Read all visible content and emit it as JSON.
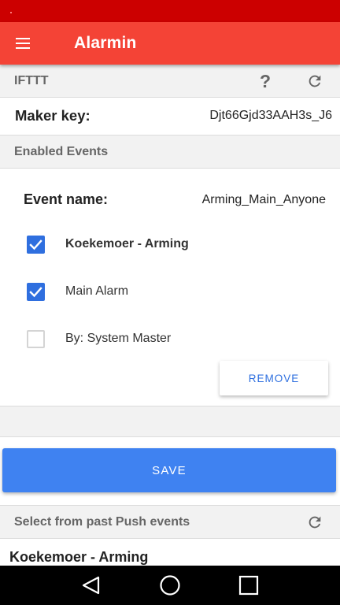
{
  "app_bar": {
    "title": "Alarmin",
    "menu_icon": "menu-icon"
  },
  "ifttt_section": {
    "header": "IFTTT",
    "help_glyph": "?",
    "refresh_icon": "refresh-icon"
  },
  "maker": {
    "label": "Maker key:",
    "value": "Djt66Gjd33AAH3s_J6"
  },
  "enabled_events": {
    "header": "Enabled Events",
    "event_name_label": "Event name:",
    "event_name_value": "Arming_Main_Anyone",
    "options": [
      {
        "label": "Koekemoer - Arming",
        "checked": true
      },
      {
        "label": "Main Alarm",
        "checked": true
      },
      {
        "label": "By: System Master",
        "checked": false
      }
    ],
    "remove_label": "REMOVE"
  },
  "save_label": "SAVE",
  "past_events": {
    "header": "Select from past Push events",
    "refresh_icon": "refresh-icon",
    "items": [
      "Koekemoer - Arming"
    ]
  },
  "colors": {
    "status_bar": "#cc0000",
    "app_bar": "#f44336",
    "accent": "#3f82f1",
    "checkbox": "#2f6fdf"
  },
  "nav": {
    "back_icon": "back-icon",
    "home_icon": "home-icon",
    "recents_icon": "recents-icon"
  }
}
